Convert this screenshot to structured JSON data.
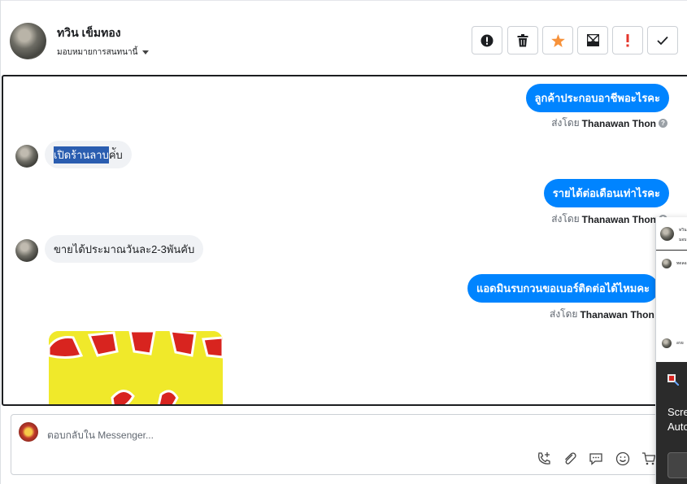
{
  "header": {
    "contact_name": "ทวิน เข็มทอง",
    "assign_label": "มอบหมายการสนทนานี้"
  },
  "toolbar": {
    "actions": [
      {
        "name": "report-spam-button",
        "icon": "exclamation-circle-icon"
      },
      {
        "name": "delete-button",
        "icon": "trash-icon"
      },
      {
        "name": "star-button",
        "icon": "star-icon",
        "color": "#f7923a"
      },
      {
        "name": "mark-unread-button",
        "icon": "envelope-x-icon"
      },
      {
        "name": "follow-up-button",
        "icon": "exclamation-icon",
        "color": "#e4362b"
      },
      {
        "name": "done-button",
        "icon": "check-icon"
      }
    ]
  },
  "chat": {
    "messages": [
      {
        "direction": "out",
        "text": "ลูกค้าประกอบอาชีพอะไรคะ",
        "sent_by_prefix": "ส่งโดย",
        "sent_by_name": "Thanawan Thon"
      },
      {
        "direction": "in",
        "text_selected": "เปิดร้านลาบ",
        "text_rest": "ค่ับ"
      },
      {
        "direction": "out",
        "text": "รายได้ต่อเดือนเท่าไรคะ",
        "sent_by_prefix": "ส่งโดย",
        "sent_by_name": "Thanawan Thon"
      },
      {
        "direction": "in",
        "text": "ขายได้ประมาณวันละ2-3พันคับ"
      },
      {
        "direction": "out",
        "text": "แอดมินรบกวนขอเบอร์ติดต่อได้ไหมคะ",
        "sent_by_prefix": "ส่งโดย",
        "sent_by_name": "Thanawan Thon"
      }
    ]
  },
  "reply": {
    "placeholder": "ตอบกลับใน Messenger..."
  },
  "popup": {
    "lines": [
      "Scre",
      "Auto"
    ],
    "snippet_1": "ทวิน",
    "snippet_2": "มอบ",
    "snippet_3": "ทดลอ",
    "snippet_4": "อรย"
  },
  "colors": {
    "accent": "#0084ff",
    "incoming_bubble": "#f0f2f5",
    "selection": "#2a5db0"
  }
}
